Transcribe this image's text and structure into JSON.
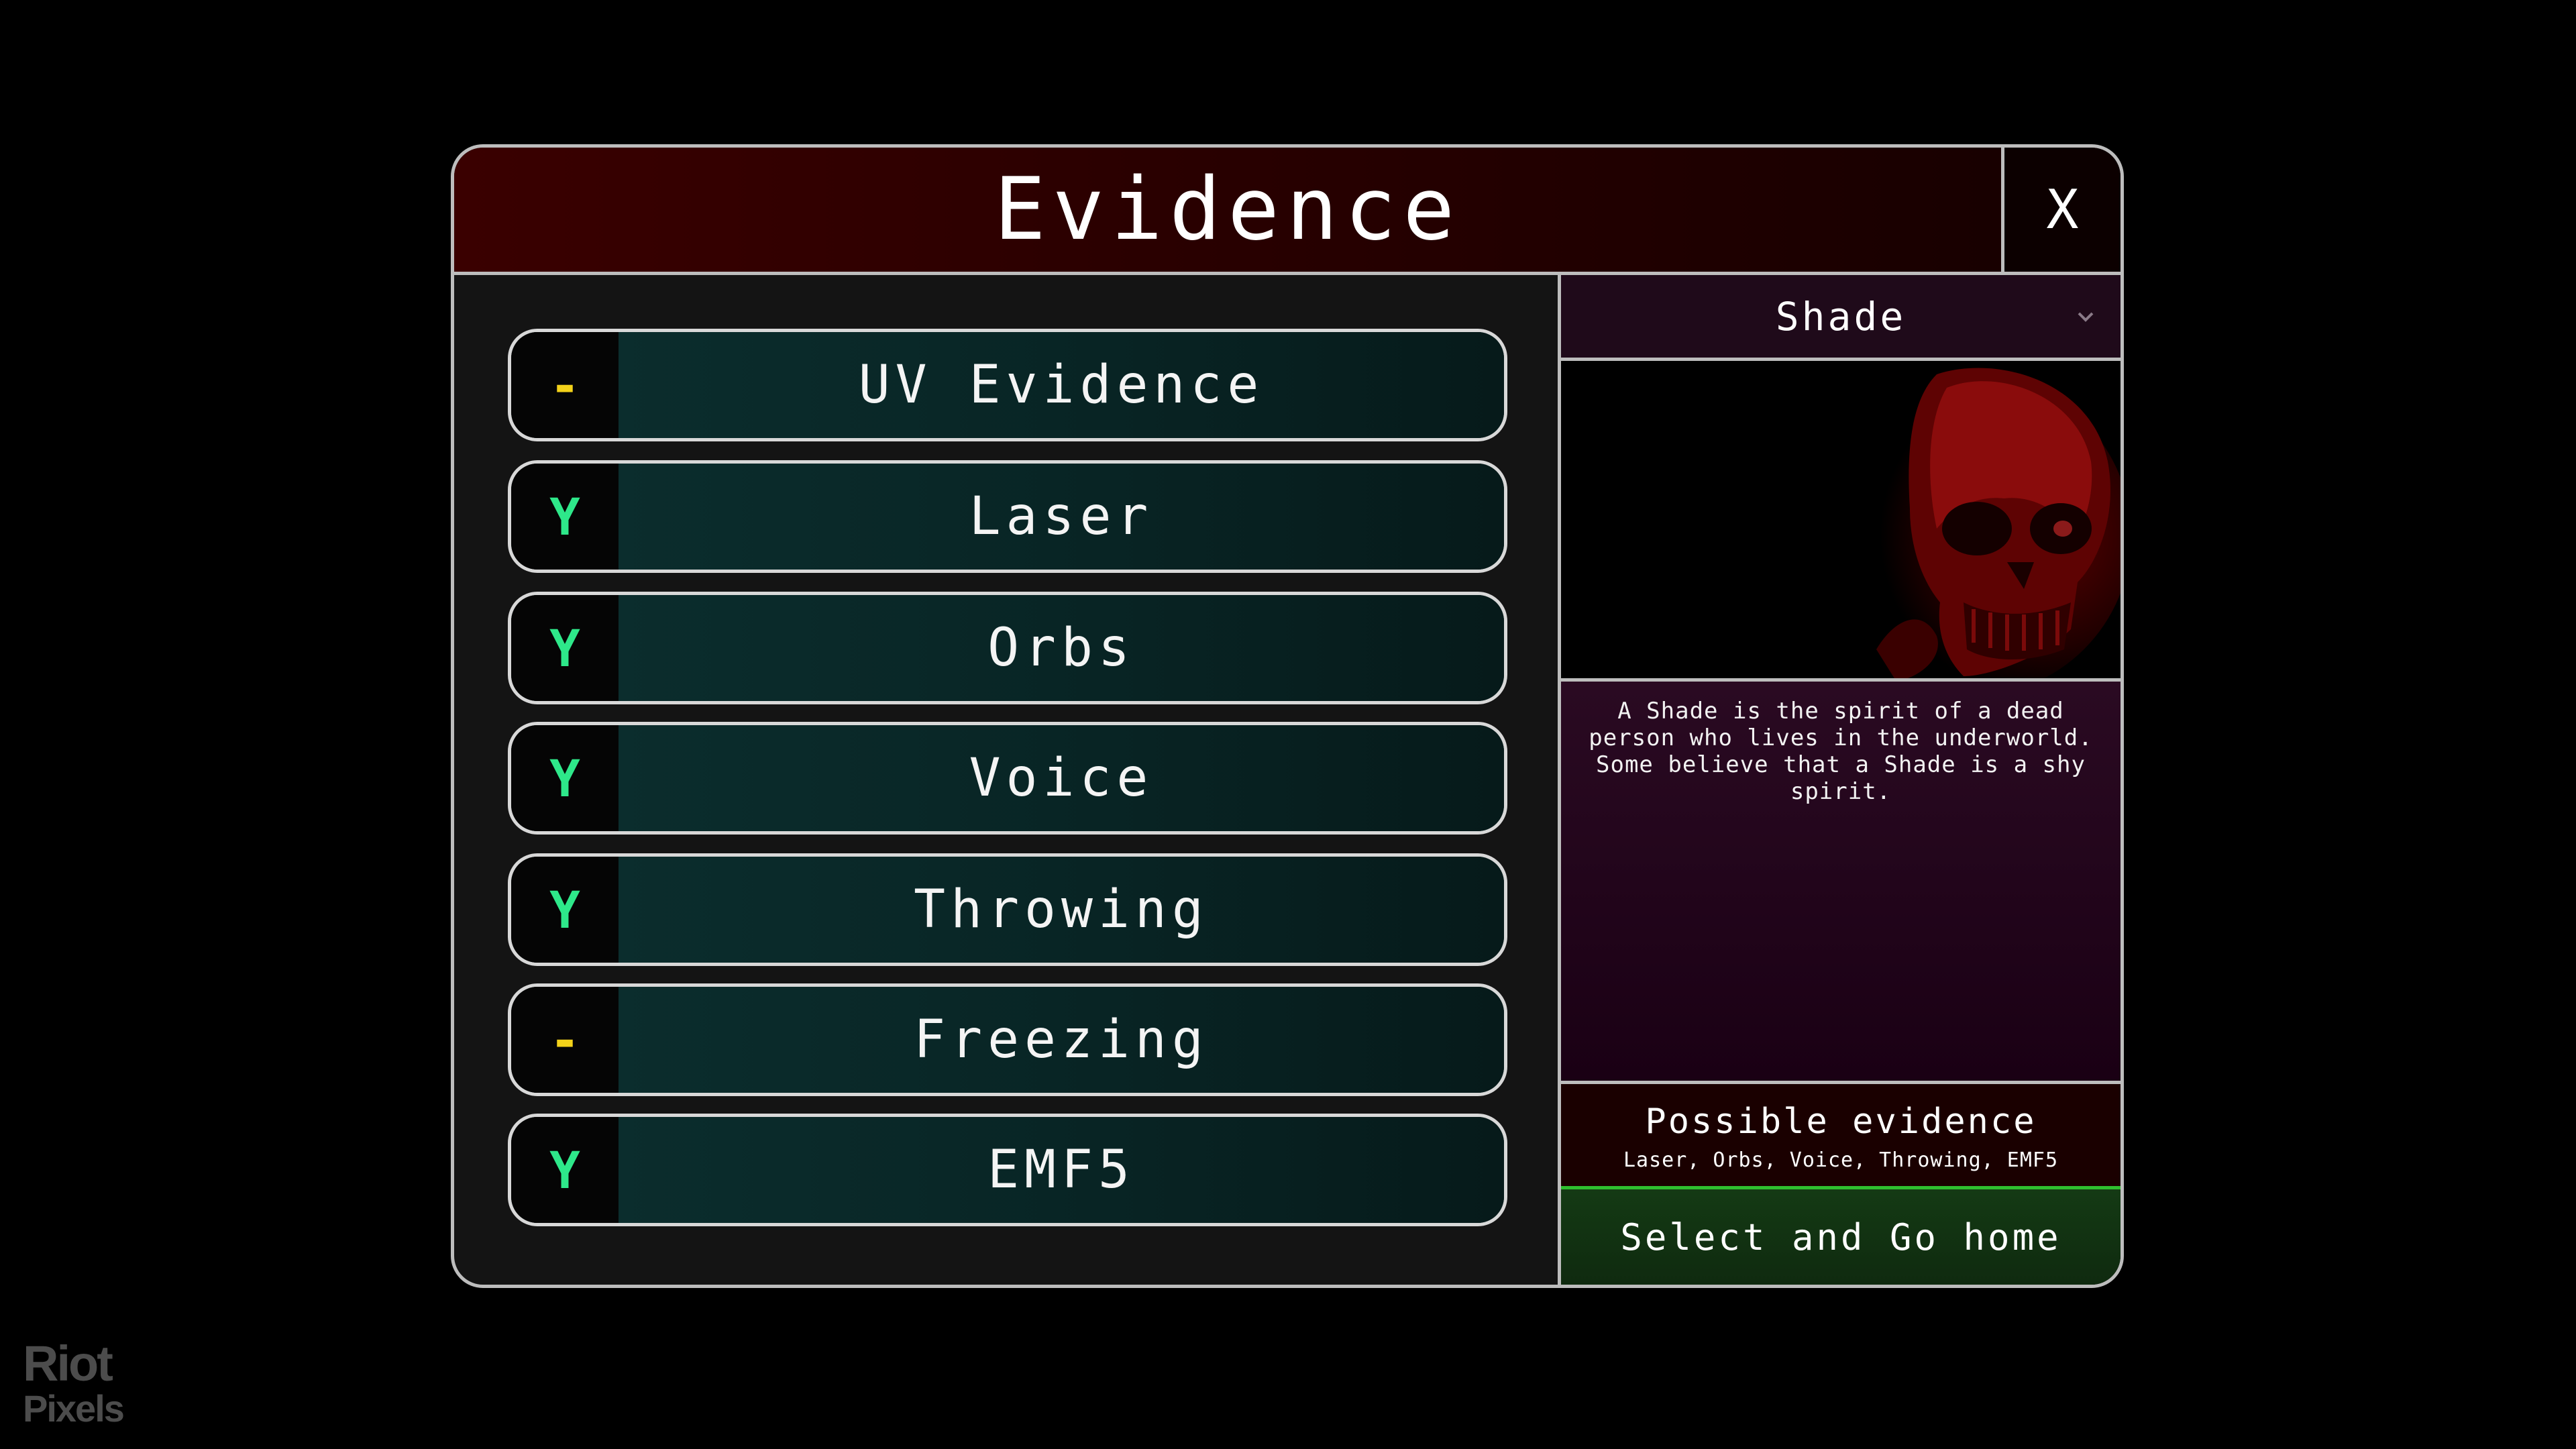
{
  "dialog": {
    "title": "Evidence",
    "close_label": "X"
  },
  "evidence": [
    {
      "status": "-",
      "status_kind": "maybe",
      "label": "UV Evidence"
    },
    {
      "status": "Y",
      "status_kind": "yes",
      "label": "Laser"
    },
    {
      "status": "Y",
      "status_kind": "yes",
      "label": "Orbs"
    },
    {
      "status": "Y",
      "status_kind": "yes",
      "label": "Voice"
    },
    {
      "status": "Y",
      "status_kind": "yes",
      "label": "Throwing"
    },
    {
      "status": "-",
      "status_kind": "maybe",
      "label": "Freezing"
    },
    {
      "status": "Y",
      "status_kind": "yes",
      "label": "EMF5"
    }
  ],
  "ghost": {
    "selected": "Shade",
    "image_icon": "red-skull-ghost-portrait",
    "description": "A Shade is the spirit of a dead person who lives in the underworld. Some believe that a Shade is a shy spirit.",
    "possible_title": "Possible evidence",
    "possible_list": "Laser, Orbs, Voice, Throwing, EMF5"
  },
  "actions": {
    "select_label": "Select and Go home"
  },
  "watermark": {
    "line1": "Riot",
    "line2": "Pixels"
  },
  "colors": {
    "yes": "#2ee88a",
    "maybe": "#f3d21a",
    "confirm_border": "#2fbf2f"
  }
}
